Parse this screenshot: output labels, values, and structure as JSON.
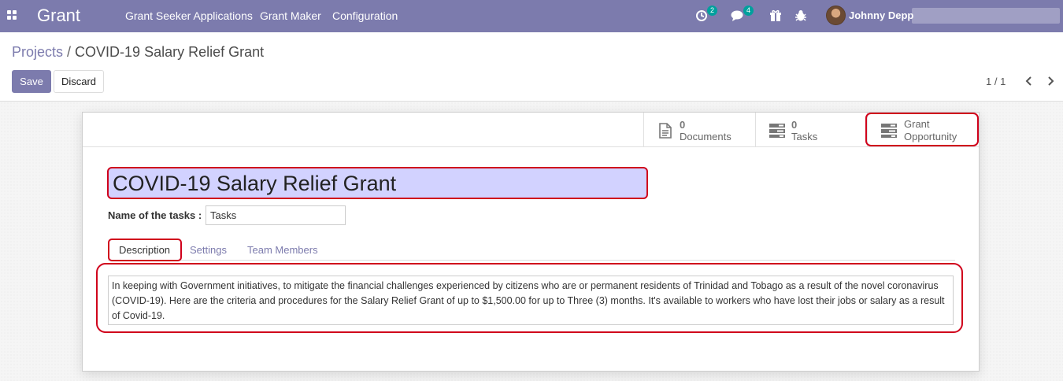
{
  "navbar": {
    "brand": "Grant",
    "menu": [
      "Grant Seeker Applications",
      "Grant Maker",
      "Configuration"
    ],
    "activity_count": "2",
    "messages_count": "4",
    "user_name": "Johnny Depp",
    "colors": {
      "bar": "#7c7bad",
      "badge": "#00a09d"
    }
  },
  "breadcrumb": {
    "parent": "Projects",
    "separator": "/",
    "current": "COVID-19 Salary Relief Grant"
  },
  "actions": {
    "save": "Save",
    "discard": "Discard"
  },
  "pager": {
    "text": "1 / 1"
  },
  "smart_buttons": [
    {
      "count": "0",
      "label": "Documents",
      "icon": "file-text-icon"
    },
    {
      "count": "0",
      "label": "Tasks",
      "icon": "tasks-icon"
    },
    {
      "label_line1": "Grant",
      "label_line2": "Opportunity",
      "icon": "tasks-icon"
    }
  ],
  "form": {
    "title": "COVID-19 Salary Relief Grant",
    "tasks_label": "Name of the tasks :",
    "tasks_value": "Tasks"
  },
  "tabs": [
    "Description",
    "Settings",
    "Team Members"
  ],
  "description": "In keeping with Government initiatives, to mitigate the financial challenges experienced by citizens who are or permanent residents of Trinidad and Tobago as a result of the novel coronavirus (COVID-19). Here are the criteria and procedures for the Salary Relief Grant of up to $1,500.00 for up to Three (3) months. It's available to workers who have lost their jobs or salary as a result of Covid-19.",
  "highlight_color": "#d0011b"
}
